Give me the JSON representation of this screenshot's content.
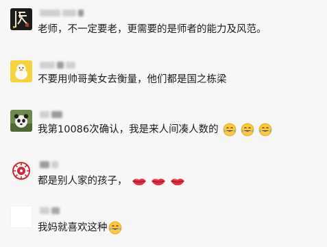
{
  "comments": [
    {
      "username": "",
      "avatar_icon": "dark-calligraphy-avatar",
      "text": "老师，不一定要老，更需要的是师者的能力及风范。",
      "emojis": []
    },
    {
      "username": "",
      "avatar_icon": "yellow-duck-avatar",
      "text": "不要用帅哥美女去衡量，他们都是国之栋梁",
      "emojis": []
    },
    {
      "username": "",
      "avatar_icon": "panda-avatar",
      "text": "我第10086次确认，我是来人间凑人数的",
      "emojis": [
        "laugh-cry-emoji",
        "laugh-cry-emoji",
        "laugh-cry-emoji"
      ]
    },
    {
      "username": "",
      "avatar_icon": "red-seal-avatar",
      "text": "都是别人家的孩子，",
      "emojis": [
        "lips-emoji",
        "lips-emoji",
        "lips-emoji"
      ]
    },
    {
      "username": "",
      "avatar_icon": "blank-avatar",
      "text": "我妈就喜欢这种",
      "emojis": [
        "laugh-cry-emoji"
      ]
    }
  ]
}
